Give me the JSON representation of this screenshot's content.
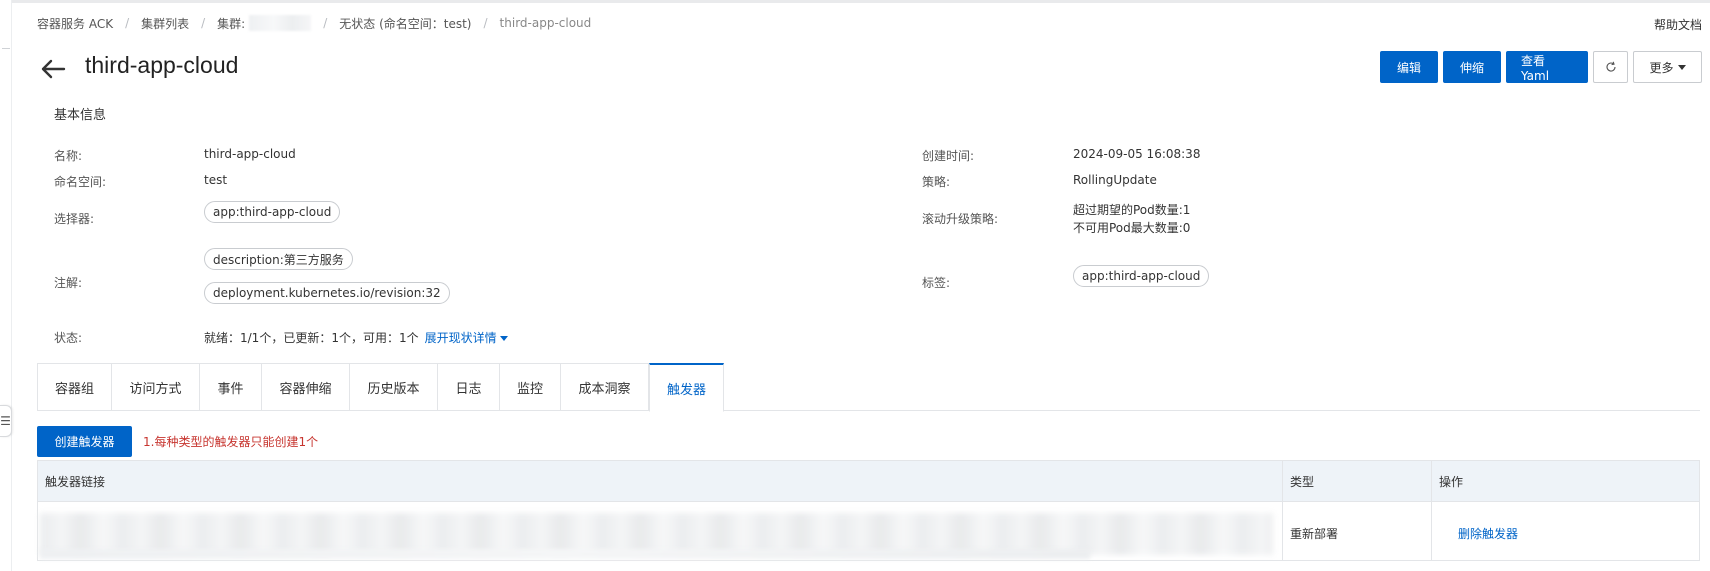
{
  "breadcrumb": {
    "items": [
      "容器服务 ACK",
      "集群列表",
      "集群:",
      "无状态 (命名空间：test)",
      "third-app-cloud"
    ]
  },
  "help_link": "帮助文档",
  "page_title": "third-app-cloud",
  "actions": {
    "edit": "编辑",
    "scale": "伸缩",
    "view_yaml": "查看Yaml",
    "more": "更多"
  },
  "basic_info": {
    "section_title": "基本信息",
    "name_label": "名称:",
    "name_value": "third-app-cloud",
    "namespace_label": "命名空间:",
    "namespace_value": "test",
    "selector_label": "选择器:",
    "selector_tag": "app:third-app-cloud",
    "annotations_label": "注解:",
    "annotations": [
      "description:第三方服务",
      "deployment.kubernetes.io/revision:32"
    ],
    "status_label": "状态:",
    "status_value": "就绪：1/1个，已更新：1个，可用：1个",
    "status_expand": "展开现状详情",
    "created_label": "创建时间:",
    "created_value": "2024-09-05 16:08:38",
    "strategy_label": "策略:",
    "strategy_value": "RollingUpdate",
    "rolling_label": "滚动升级策略:",
    "rolling_lines": [
      "超过期望的Pod数量:1",
      "不可用Pod最大数量:0"
    ],
    "labels_label": "标签:",
    "labels_tag": "app:third-app-cloud"
  },
  "tabs": [
    "容器组",
    "访问方式",
    "事件",
    "容器伸缩",
    "历史版本",
    "日志",
    "监控",
    "成本洞察",
    "触发器"
  ],
  "active_tab": "触发器",
  "trigger": {
    "create_button": "创建触发器",
    "hint": "1.每种类型的触发器只能创建1个",
    "columns": [
      "触发器链接",
      "类型",
      "操作"
    ],
    "rows": [
      {
        "type": "重新部署",
        "action": "删除触发器"
      }
    ]
  },
  "colors": {
    "primary": "#0064c8",
    "hint": "#c7352f",
    "table_header": "#eef3f8"
  }
}
